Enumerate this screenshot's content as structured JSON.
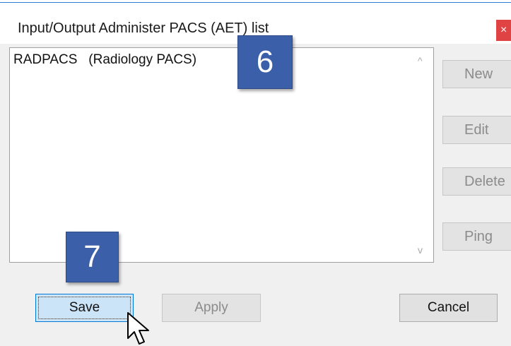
{
  "window": {
    "title": "Input/Output Administer PACS (AET) list",
    "close_glyph": "×"
  },
  "pacs_list": {
    "items": [
      "RADPACS   (Radiology PACS)"
    ]
  },
  "scrollbar": {
    "up_glyph": "^",
    "down_glyph": "v"
  },
  "side_buttons": {
    "new_label": "New",
    "edit_label": "Edit",
    "delete_label": "Delete",
    "ping_label": "Ping"
  },
  "callouts": {
    "step_6": "6",
    "step_7": "7",
    "color": "#3b5fa8"
  },
  "footer": {
    "save_label": "Save",
    "apply_label": "Apply",
    "cancel_label": "Cancel"
  },
  "colors": {
    "accent": "#0078d7",
    "close": "#e04343",
    "window_bg": "#f0f0f0"
  },
  "icons": {
    "cursor": "arrow-cursor-icon"
  }
}
